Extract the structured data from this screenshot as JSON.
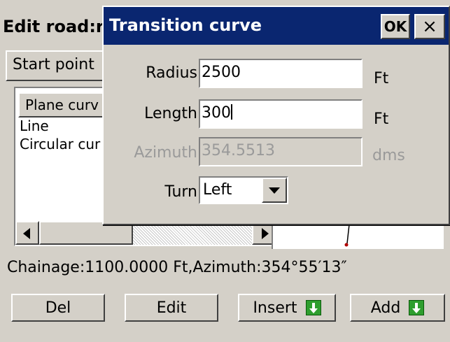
{
  "background_window": {
    "title": "Edit road:r",
    "start_button_label": "Start point",
    "list": {
      "header": "Plane curv",
      "items": [
        "Line",
        "Circular cur"
      ]
    },
    "status_text": "Chainage:1100.0000 Ft,Azimuth:354°55′13″",
    "buttons": {
      "del": "Del",
      "edit": "Edit",
      "insert": "Insert",
      "add": "Add"
    },
    "icons": {
      "insert": "green-down-arrow-icon",
      "add": "green-down-arrow-icon"
    }
  },
  "dialog": {
    "title": "Transition curve",
    "ok_label": "OK",
    "close_label": "×",
    "fields": {
      "radius": {
        "label": "Radius",
        "value": "2500",
        "unit": "Ft"
      },
      "length": {
        "label": "Length",
        "value": "300",
        "unit": "Ft"
      },
      "azimuth": {
        "label": "Azimuth",
        "value": "354.5513",
        "unit": "dms"
      },
      "turn": {
        "label": "Turn",
        "value": "Left"
      }
    }
  },
  "colors": {
    "dialog_titlebar": "#0a2670",
    "window_face": "#d4d0c8",
    "disabled_text": "#9a9a9a",
    "icon_green": "#2e9e2e"
  }
}
